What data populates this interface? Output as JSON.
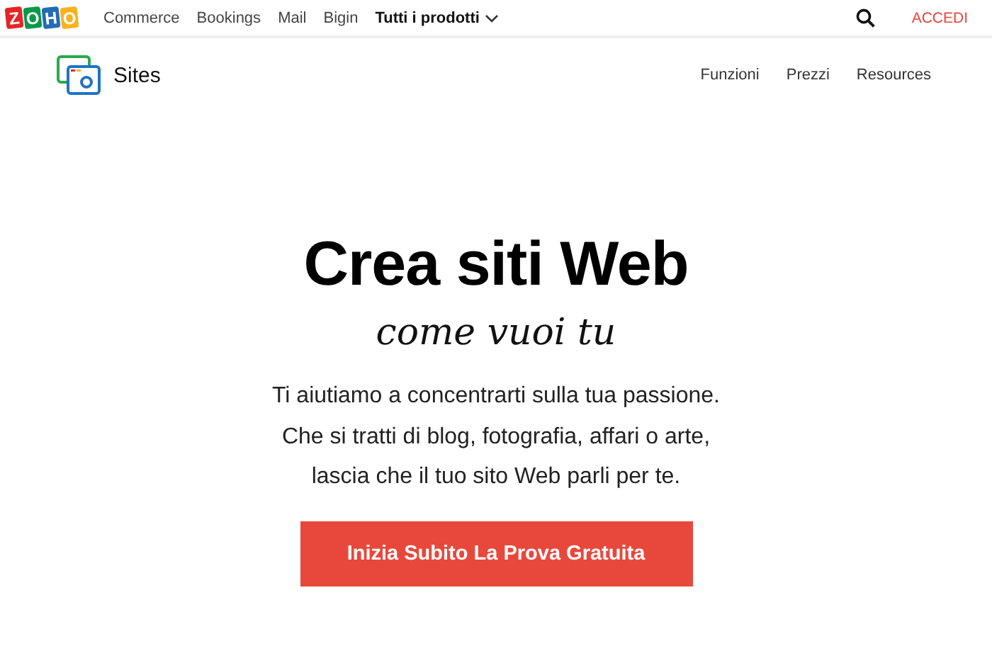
{
  "top_bar": {
    "logo_letters": [
      {
        "text": "Z",
        "color": "#e42527"
      },
      {
        "text": "O",
        "color": "#089949"
      },
      {
        "text": "H",
        "color": "#226db4"
      },
      {
        "text": "O",
        "color": "#f9b21d"
      }
    ],
    "links": [
      "Commerce",
      "Bookings",
      "Mail",
      "Bigin"
    ],
    "products_menu": {
      "label": "Tutti i prodotti",
      "expanded": false
    },
    "sign_in": "ACCEDI"
  },
  "site_nav": {
    "brand": "Sites",
    "links": [
      "Funzioni",
      "Prezzi",
      "Resources"
    ]
  },
  "hero": {
    "title": "Crea siti Web",
    "subtitle": "come vuoi tu",
    "lines": [
      "Ti aiutiamo a concentrarti sulla tua passione.",
      "Che si tratti di blog, fotografia, affari o arte,",
      "lascia che il tuo sito Web parli per te."
    ],
    "cta": "Inizia Subito La Prova Gratuita"
  }
}
